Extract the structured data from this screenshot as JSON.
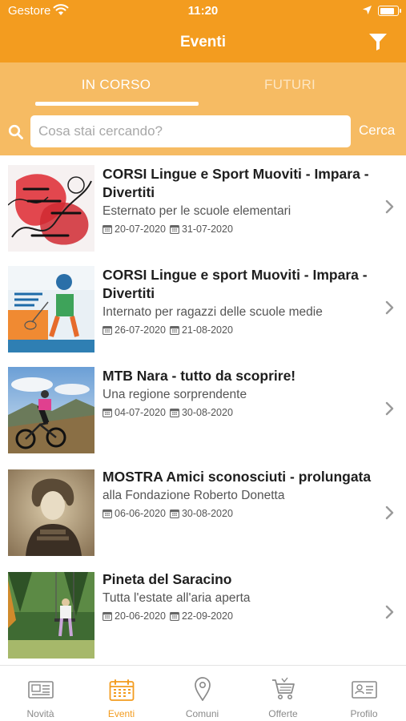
{
  "status": {
    "carrier": "Gestore",
    "time": "11:20",
    "battery_level": 0.85
  },
  "header": {
    "title": "Eventi",
    "filter_icon": "filter-icon"
  },
  "tabs": [
    {
      "label": "IN CORSO",
      "active": true
    },
    {
      "label": "FUTURI",
      "active": false
    }
  ],
  "search": {
    "placeholder": "Cosa stai cercando?",
    "value": "",
    "action_label": "Cerca"
  },
  "events": [
    {
      "title": "CORSI Lingue e Sport Muoviti - Impara - Divertiti",
      "subtitle": "Esternato per le scuole elementari",
      "date_start": "20-07-2020",
      "date_end": "31-07-2020"
    },
    {
      "title": "CORSI Lingue e sport Muoviti - Impara - Divertiti",
      "subtitle": "Internato per ragazzi delle scuole medie",
      "date_start": "26-07-2020",
      "date_end": "21-08-2020"
    },
    {
      "title": "MTB Nara - tutto da scoprire!",
      "subtitle": "Una regione sorprendente",
      "date_start": "04-07-2020",
      "date_end": "30-08-2020"
    },
    {
      "title": "MOSTRA Amici sconosciuti - prolungata",
      "subtitle": "alla Fondazione Roberto Donetta",
      "date_start": "06-06-2020",
      "date_end": "30-08-2020"
    },
    {
      "title": "Pineta del Saracino",
      "subtitle": "Tutta l'estate all'aria aperta",
      "date_start": "20-06-2020",
      "date_end": "22-09-2020"
    }
  ],
  "tabbar": [
    {
      "label": "Novità",
      "icon": "newspaper-icon",
      "active": false
    },
    {
      "label": "Eventi",
      "icon": "calendar-icon",
      "active": true
    },
    {
      "label": "Comuni",
      "icon": "map-pin-icon",
      "active": false
    },
    {
      "label": "Offerte",
      "icon": "shopping-cart-icon",
      "active": false
    },
    {
      "label": "Profilo",
      "icon": "id-card-icon",
      "active": false
    }
  ],
  "colors": {
    "accent": "#f39c1f",
    "accent_light": "#f6bb63",
    "text": "#1e1e1e",
    "muted": "#8a8a8a"
  }
}
